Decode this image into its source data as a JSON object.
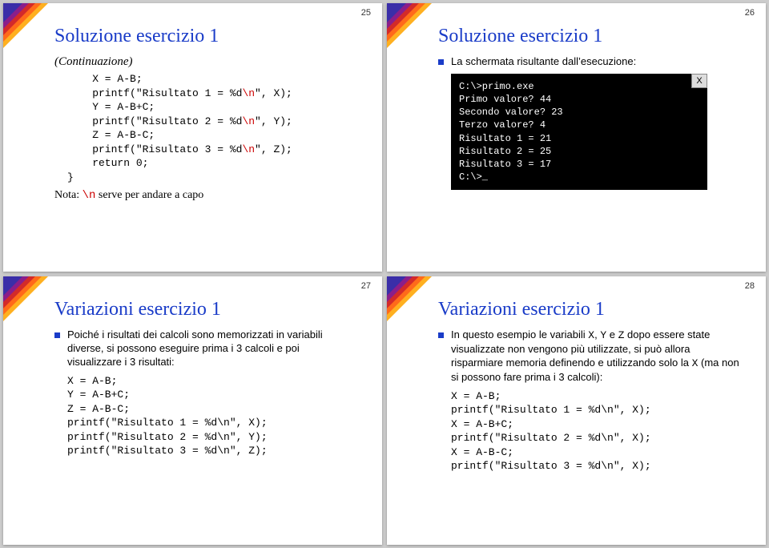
{
  "slides": {
    "s25": {
      "num": "25",
      "title": "Soluzione esercizio 1",
      "sub": "(Continuazione)",
      "code_pre": "    X = A-B;\n    printf(\"Risultato 1 = %d",
      "code_n1": "\\n",
      "code_mid1": "\", X);\n    Y = A-B+C;\n    printf(\"Risultato 2 = %d",
      "code_n2": "\\n",
      "code_mid2": "\", Y);\n    Z = A-B-C;\n    printf(\"Risultato 3 = %d",
      "code_n3": "\\n",
      "code_post": "\", Z);\n    return 0;\n}",
      "note_a": "Nota: ",
      "note_n": "\\n",
      "note_b": " serve per andare a capo"
    },
    "s26": {
      "num": "26",
      "title": "Soluzione esercizio 1",
      "bullet": "La schermata risultante dall’esecuzione:",
      "term": "C:\\>primo.exe\nPrimo valore? 44\nSecondo valore? 23\nTerzo valore? 4\nRisultato 1 = 21\nRisultato 2 = 25\nRisultato 3 = 17\nC:\\>_",
      "close_x": "X"
    },
    "s27": {
      "num": "27",
      "title": "Variazioni esercizio 1",
      "bullet": "Poiché i risultati dei calcoli sono memorizzati in variabili diverse, si possono eseguire prima i 3 calcoli e poi visualizzare i 3 risultati:",
      "code": "X = A-B;\nY = A-B+C;\nZ = A-B-C;\nprintf(\"Risultato 1 = %d\\n\", X);\nprintf(\"Risultato 2 = %d\\n\", Y);\nprintf(\"Risultato 3 = %d\\n\", Z);"
    },
    "s28": {
      "num": "28",
      "title": "Variazioni esercizio 1",
      "bullet_a": "In questo esempio le variabili ",
      "bullet_x": "X",
      "bullet_c1": ", ",
      "bullet_y": "Y",
      "bullet_c2": " e ",
      "bullet_z": "Z",
      "bullet_b": " dopo essere state visualizzate non vengono più utilizzate, si può allora risparmiare memoria definendo e utilizzando solo la ",
      "bullet_x2": "X",
      "bullet_c": " (ma non si possono fare prima i 3 calcoli):",
      "code": "X = A-B;\nprintf(\"Risultato 1 = %d\\n\", X);\nX = A-B+C;\nprintf(\"Risultato 2 = %d\\n\", X);\nX = A-B-C;\nprintf(\"Risultato 3 = %d\\n\", X);"
    }
  }
}
